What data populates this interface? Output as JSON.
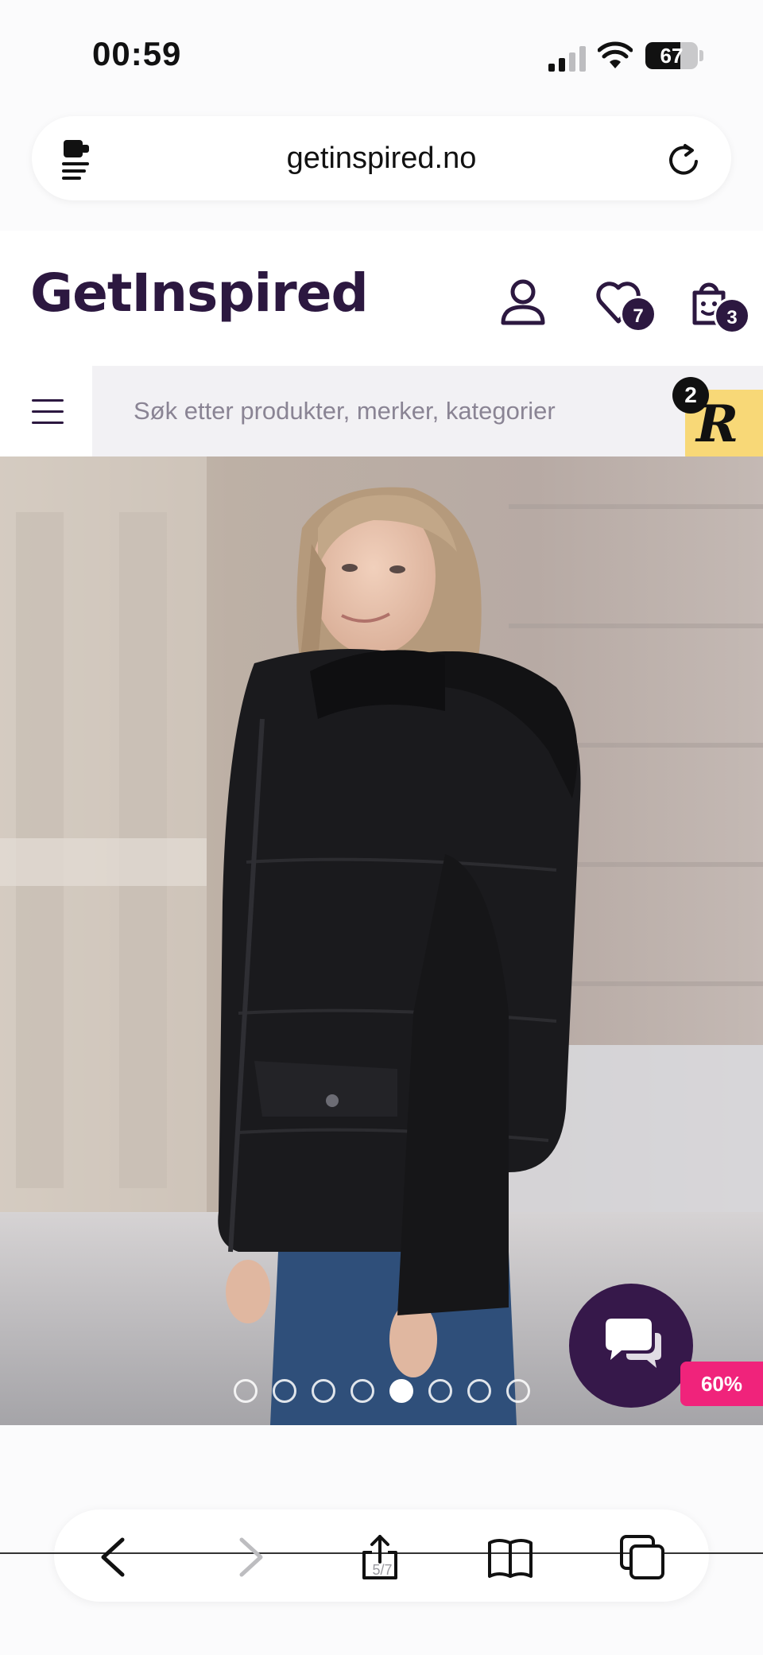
{
  "status_bar": {
    "time": "00:59",
    "battery": "67",
    "battery_level": 0.67
  },
  "browser": {
    "url": "getinspired.no",
    "page_indicator": "5/7"
  },
  "site": {
    "logo": "GetInspired",
    "wishlist_count": "7",
    "cart_count": "3",
    "search_placeholder": "Søk etter produkter, merker, kategorier",
    "widget_count": "2",
    "widget_letter": "R"
  },
  "product": {
    "discount": "60%",
    "image_count": 8,
    "active_image": 4
  },
  "colors": {
    "brand": "#2c1840",
    "accent_pink": "#f0237b",
    "widget_yellow": "#f8d877"
  },
  "icons": [
    "extension-icon",
    "reload-icon",
    "account-icon",
    "heart-icon",
    "cart-icon",
    "menu-icon",
    "chat-icon",
    "back-icon",
    "forward-icon",
    "share-icon",
    "bookmarks-icon",
    "tabs-icon"
  ]
}
